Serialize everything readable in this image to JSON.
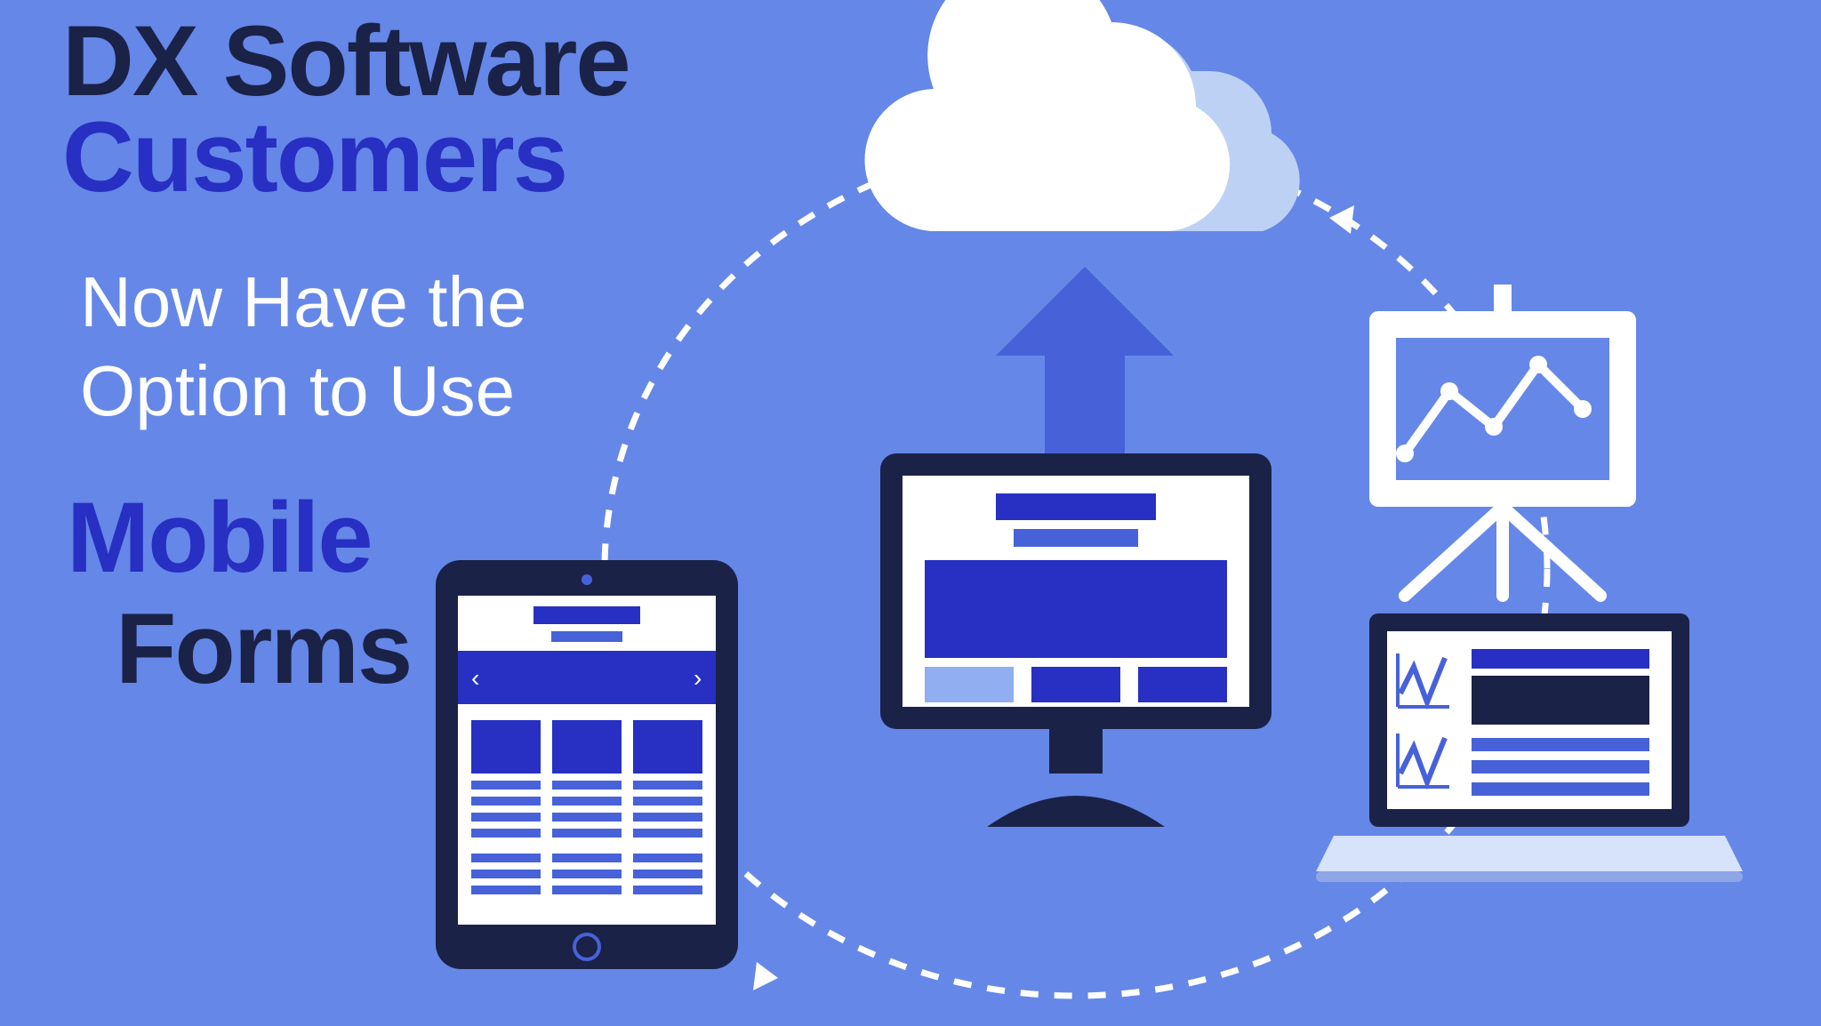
{
  "headline": {
    "line1": "DX Software",
    "line2": "Customers"
  },
  "subhead": {
    "line1": "Now Have the",
    "line2": "Option to Use"
  },
  "cta": {
    "mobile": "Mobile",
    "forms": "Forms"
  },
  "colors": {
    "bg": "#6587e8",
    "dark_navy": "#1b2247",
    "royal_blue": "#2730c2",
    "white": "#ffffff",
    "light_cloud": "#bdd1f4",
    "mid_blue": "#4762d8",
    "pale_blue": "#90aef0"
  }
}
